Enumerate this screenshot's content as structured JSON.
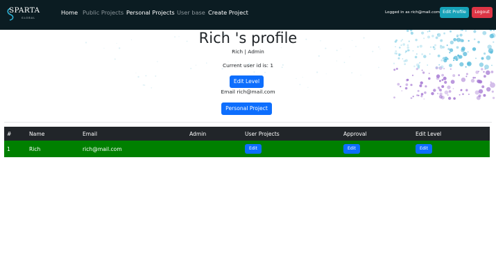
{
  "brand": {
    "name": "SPARTA",
    "sub": "GLOBAL"
  },
  "nav": {
    "home": "Home",
    "public_projects": "Public Projects",
    "personal_projects": "Personal Projects",
    "user_base": "User base",
    "create_project": "Create Project",
    "logged_in": "Logged in as rich@mail.com",
    "edit_profile": "Edit Profile",
    "logout": "Logout"
  },
  "profile": {
    "title": "Rich 's profile",
    "role": "Rich | Admin",
    "user_id": "Current user id is: 1",
    "edit_level": "Edit Level",
    "email": "Email rich@mail.com",
    "personal_project": "Personal Project"
  },
  "table": {
    "headers": [
      "#",
      "Name",
      "Email",
      "Admin",
      "User Projects",
      "Approval",
      "Edit Level"
    ],
    "rows": [
      {
        "id": "1",
        "name": "Rich",
        "email": "rich@mail.com",
        "admin": "",
        "user_projects": "Edit",
        "approval": "Edit",
        "edit_level": "Edit"
      }
    ]
  },
  "colors": {
    "navbar": "#0b1c22",
    "primary": "#0d6efd",
    "info": "#17a2b8",
    "danger": "#dc3545",
    "row_success": "#008000",
    "table_head": "#212529"
  }
}
